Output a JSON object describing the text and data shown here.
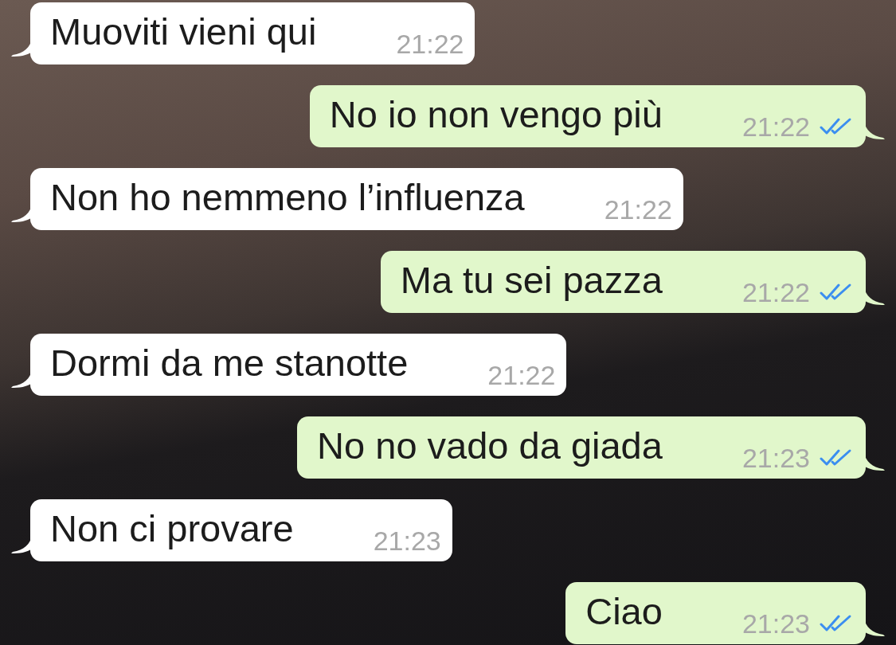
{
  "messages": [
    {
      "outgoing": false,
      "text": "Muoviti vieni qui",
      "time": "21:22"
    },
    {
      "outgoing": true,
      "text": "No io non vengo più",
      "time": "21:22",
      "read": true
    },
    {
      "outgoing": false,
      "text": "Non ho nemmeno l’influenza",
      "time": "21:22"
    },
    {
      "outgoing": true,
      "text": "Ma tu sei pazza",
      "time": "21:22",
      "read": true
    },
    {
      "outgoing": false,
      "text": "Dormi da me stanotte",
      "time": "21:22"
    },
    {
      "outgoing": true,
      "text": "No no vado da giada",
      "time": "21:23",
      "read": true
    },
    {
      "outgoing": false,
      "text": "Non ci provare",
      "time": "21:23"
    },
    {
      "outgoing": true,
      "text": "Ciao",
      "time": "21:23",
      "read": true
    }
  ]
}
